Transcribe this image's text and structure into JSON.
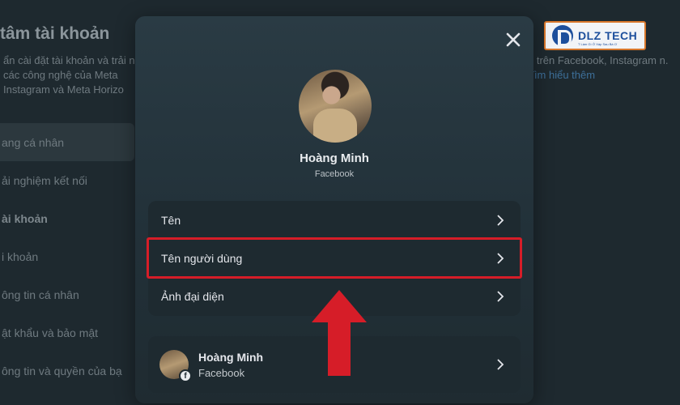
{
  "background": {
    "title": "tâm tài khoản",
    "description": "ẩn cài đặt tài khoản và trải n các công nghệ của Meta Instagram và Meta Horizo",
    "description_right": "n trên Facebook, Instagram n.",
    "description_right_link": "Tìm hiểu thêm",
    "nav": [
      {
        "label": "ang cá nhân"
      },
      {
        "label": "ải nghiệm kết nối"
      },
      {
        "label": "ài khoản"
      },
      {
        "label": "i khoản"
      },
      {
        "label": "ông tin cá nhân"
      },
      {
        "label": "ật khẩu và bảo mật"
      },
      {
        "label": "ông tin và quyền của bạ"
      }
    ]
  },
  "logo": {
    "text": "DLZ TECH",
    "tagline": "T Làm Gì Ở Xáp Sau Bà Ơ"
  },
  "modal": {
    "close_icon": "close-icon",
    "profile": {
      "name": "Hoàng Minh",
      "platform": "Facebook"
    },
    "menu": [
      {
        "label": "Tên"
      },
      {
        "label": "Tên người dùng"
      },
      {
        "label": "Ảnh đại diện"
      }
    ],
    "account": {
      "name": "Hoàng Minh",
      "platform": "Facebook",
      "badge": "f"
    }
  },
  "colors": {
    "highlight": "#d61d28",
    "arrow": "#d61d28"
  }
}
